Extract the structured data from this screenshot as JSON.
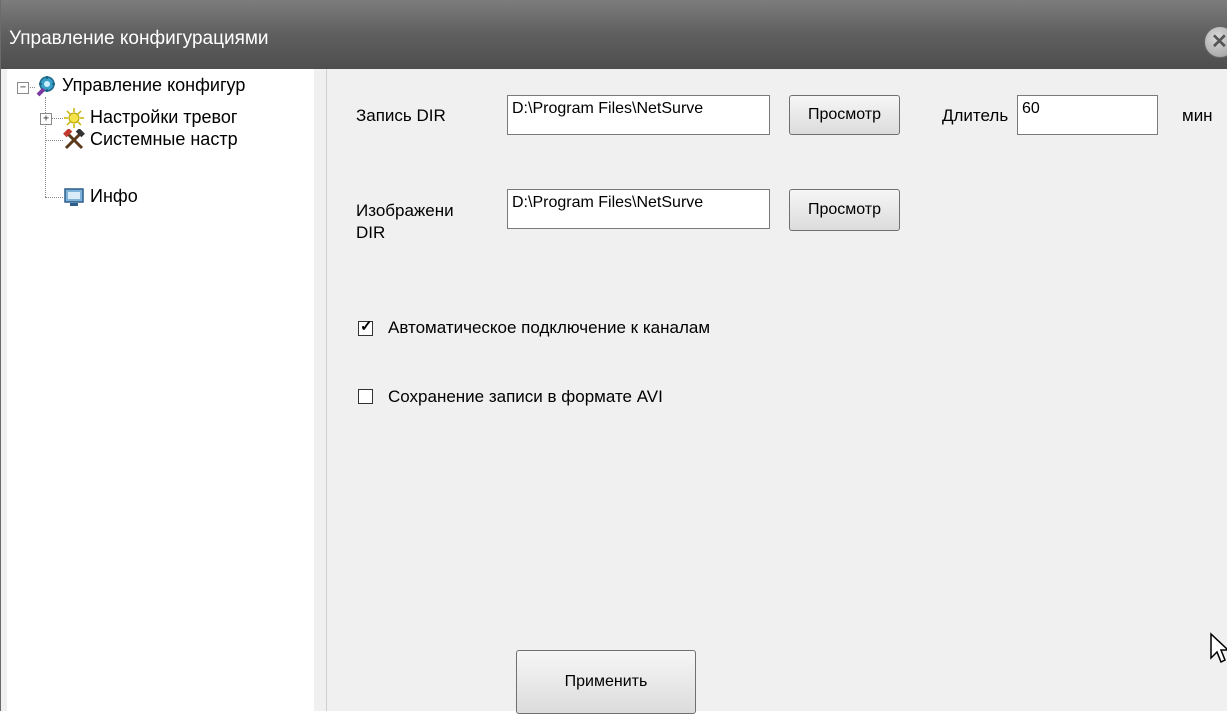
{
  "window": {
    "title": "Управление конфигурациями"
  },
  "tree": {
    "items": [
      {
        "label": "Управление конфигур",
        "icon": "config-gear-icon",
        "expander": "−"
      },
      {
        "label": "Настройки тревог",
        "icon": "alarm-light-icon",
        "expander": "+"
      },
      {
        "label": "Системные настр",
        "icon": "tools-icon"
      },
      {
        "label": "Инфо",
        "icon": "info-monitor-icon"
      }
    ]
  },
  "settings": {
    "record_dir_label": "Запись DIR",
    "record_dir_value": "D:\\Program Files\\NetSurve",
    "browse_label": "Просмотр",
    "duration_label": "Длитель",
    "duration_value": "60",
    "duration_unit": "мин",
    "image_dir_label_1": "Изображени",
    "image_dir_label_2": "DIR",
    "image_dir_value": "D:\\Program Files\\NetSurve",
    "auto_connect_label": "Автоматическое подключение к каналам",
    "auto_connect_checked": true,
    "save_avi_label": "Сохранение записи в формате AVI",
    "save_avi_checked": false,
    "apply_label": "Применить"
  }
}
